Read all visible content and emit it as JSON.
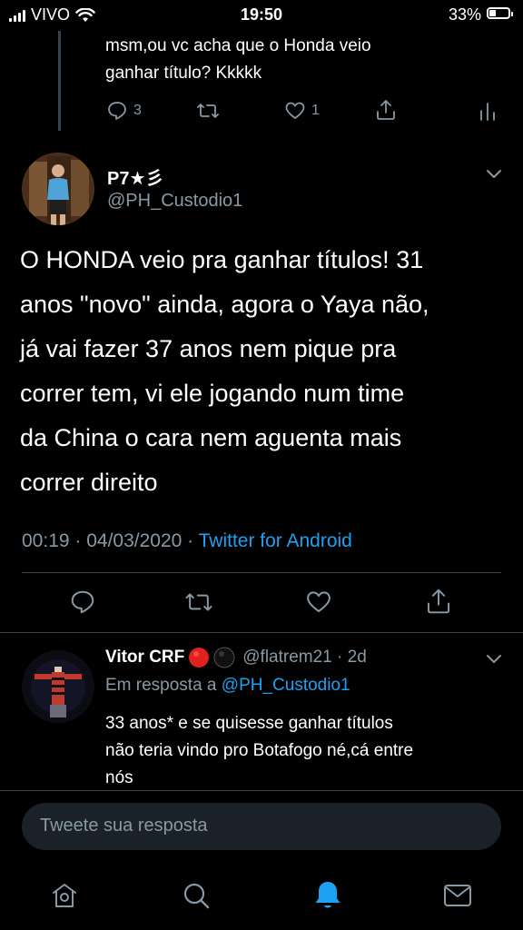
{
  "status_bar": {
    "carrier": "VIVO",
    "time": "19:50",
    "battery_percent": "33%",
    "battery_level": 0.33
  },
  "prev_tweet": {
    "text_lines": [
      "msm,ou vc acha que o Honda veio",
      "ganhar título? Kkkkk"
    ],
    "replies_count": "3",
    "likes_count": "1"
  },
  "main_tweet": {
    "display_name": "P7★彡",
    "handle": "@PH_Custodio1",
    "text_lines": [
      "O HONDA veio pra ganhar títulos! 31",
      "anos \"novo\" ainda, agora o Yaya não,",
      "já vai fazer 37 anos nem pique pra",
      "correr tem, vi ele jogando num time",
      "da China o cara nem aguenta mais",
      "correr direito"
    ],
    "timestamp": "00:19 · 04/03/2020 · ",
    "source": "Twitter for Android"
  },
  "reply": {
    "display_name": "Vitor CRF",
    "handle_time": "@flatrem21 · 2d",
    "in_reply_prefix": "Em resposta a ",
    "in_reply_handle": "@PH_Custodio1",
    "text_lines": [
      "33 anos* e se quisesse ganhar títulos",
      "não teria vindo pro Botafogo né,cá entre",
      "nós"
    ]
  },
  "composer": {
    "placeholder": "Tweete sua resposta"
  },
  "colors": {
    "accent": "#1da1f2",
    "secondary_text": "#8899a6",
    "divider": "#38444d"
  }
}
